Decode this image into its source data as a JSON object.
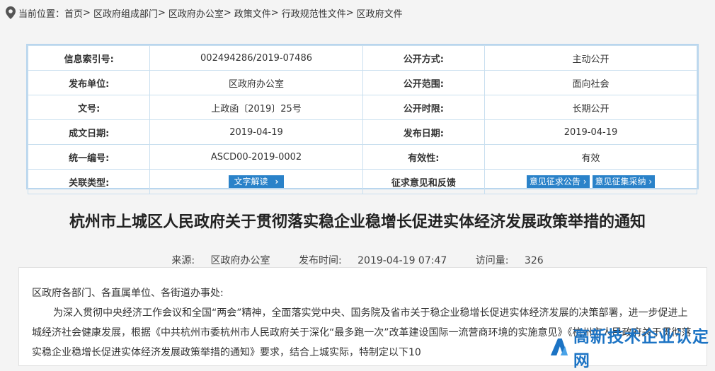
{
  "breadcrumb": {
    "label": "当前位置：",
    "items": [
      "首页",
      "区政府组成部门",
      "区政府办公室",
      "政策文件",
      "行政规范性文件",
      "区政府文件"
    ],
    "sep": ">"
  },
  "info": {
    "rows": [
      {
        "k1": "信息索引号:",
        "v1": "002494286/2019-07486",
        "k2": "公开方式:",
        "v2": "主动公开"
      },
      {
        "k1": "发布单位:",
        "v1": "区政府办公室",
        "k2": "公开范围:",
        "v2": "面向社会"
      },
      {
        "k1": "文号:",
        "v1": "上政函〔2019〕25号",
        "k2": "公开时限:",
        "v2": "长期公开"
      },
      {
        "k1": "成文日期:",
        "v1": "2019-04-19",
        "k2": "发布日期:",
        "v2": "2019-04-19"
      },
      {
        "k1": "统一编号:",
        "v1": "ASCD00-2019-0002",
        "k2": "有效性:",
        "v2": "有效"
      }
    ],
    "last": {
      "k1": "关联类型:",
      "btn_jiedu": "文字解读",
      "k2": "征求意见和反馈",
      "btn_gonggao": "意见征求公告",
      "btn_caina": "意见征集采纳"
    }
  },
  "article": {
    "title": "杭州市上城区人民政府关于贯彻落实稳企业稳增长促进实体经济发展政策举措的通知",
    "source_label": "来源:",
    "source": "区政府办公室",
    "time_label": "发布时间:",
    "time": "2019-04-19 07:47",
    "views_label": "访问量:",
    "views": "326",
    "greeting": "区政府各部门、各直属单位、各街道办事处:",
    "para1": "为深入贯彻中央经济工作会议和全国“两会”精神，全面落实党中央、国务院及省市关于稳企业稳增长促进实体经济发展的决策部署，进一步促进上城经济社会健康发展，根据《中共杭州市委杭州市人民政府关于深化“最多跑一次”改革建设国际一流营商环境的实施意见》《杭州市人民政府关于贯彻落实稳企业稳增长促进实体经济发展政策举措的通知》要求，结合上城实际，特制定以下10"
  },
  "watermark": {
    "text": "高新技术企业认定网"
  }
}
